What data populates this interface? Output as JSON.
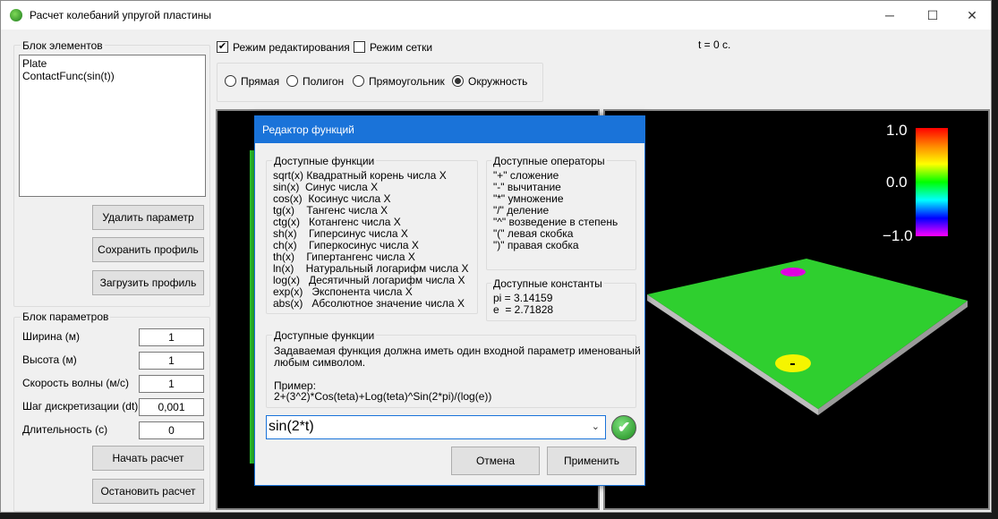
{
  "window": {
    "title": "Расчет колебаний упругой пластины",
    "minimize": "─",
    "maximize": "☐",
    "close": "✕"
  },
  "elements_block": {
    "label": "Блок элементов",
    "items": [
      "Plate",
      "ContactFunc(sin(t))"
    ],
    "delete_button": "Удалить параметр",
    "save_button": "Сохранить профиль",
    "load_button": "Загрузить профиль"
  },
  "params_block": {
    "label": "Блок параметров",
    "fields": [
      {
        "label": "Ширина (м)",
        "value": "1"
      },
      {
        "label": "Высота (м)",
        "value": "1"
      },
      {
        "label": "Скорость волны (м/с)",
        "value": "1"
      },
      {
        "label": "Шаг дискретизации (dt)",
        "value": "0,001"
      },
      {
        "label": "Длительность (с)",
        "value": "0"
      }
    ],
    "start_button": "Начать расчет",
    "stop_button": "Остановить расчет"
  },
  "toolbar": {
    "edit_mode_label": "Режим редактирования",
    "edit_mode_checked": true,
    "grid_mode_label": "Режим сетки",
    "grid_mode_checked": false,
    "time_label": "t = 0 с.",
    "shapes": [
      "Прямая",
      "Полигон",
      "Прямоугольник",
      "Окружность"
    ],
    "selected_shape": "Окружность"
  },
  "colorbar": {
    "max": "1.0",
    "mid": "0.0",
    "min": "−1.0"
  },
  "dialog": {
    "title": "Редактор функций",
    "functions_label": "Доступные функции",
    "functions": [
      "sqrt(x) Квадратный корень числа X",
      "sin(x)  Синус числа X",
      "cos(x)  Косинус числа X",
      "tg(x)    Тангенс числа X",
      "ctg(x)   Котангенс числа X",
      "sh(x)    Гиперсинус числа X",
      "ch(x)    Гиперкосинус числа X",
      "th(x)    Гипертангенс числа X",
      "ln(x)    Натуральный логарифм числа X",
      "log(x)   Десятичный логарифм числа X",
      "exp(x)   Экспонента числа X",
      "abs(x)   Абсолютное значение числа X"
    ],
    "operators_label": "Доступные операторы",
    "operators": [
      "\"+\" сложение",
      "\"-\" вычитание",
      "\"*\" умножение",
      "\"/\" деление",
      "\"^\" возведение в степень",
      "\"(\" левая скобка",
      "\")\" правая скобка"
    ],
    "constants_label": "Доступные константы",
    "constants": [
      "pi = 3.14159",
      "e  = 2.71828"
    ],
    "info_label": "Доступные функции",
    "info_text_1": "Задаваемая функция должна иметь один входной параметр именованый",
    "info_text_2": "любым символом.",
    "example_label": "Пример:",
    "example_text": "2+(3^2)*Cos(teta)+Log(teta)^Sin(2*pi)/(log(e))",
    "input_value": "sin(2*t)",
    "cancel_button": "Отмена",
    "apply_button": "Применить"
  },
  "colors": {
    "accent": "#1a73d9",
    "plate": "#2fcf2f",
    "magenta_spot": "#e000e0",
    "yellow_spot": "#f5f500"
  }
}
